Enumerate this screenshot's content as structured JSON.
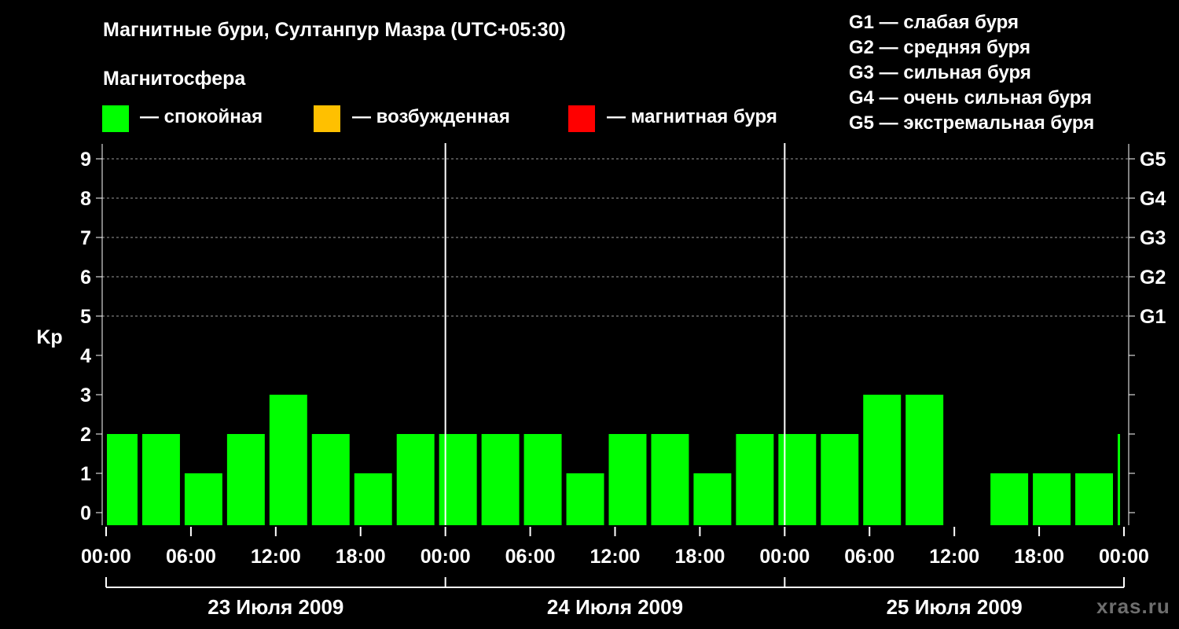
{
  "title": "Магнитные бури, Султанпур Мазра (UTC+05:30)",
  "legend": {
    "title": "Магнитосфера",
    "items": [
      {
        "label": "— спокойная",
        "color": "#00ff00"
      },
      {
        "label": "— возбужденная",
        "color": "#ffc000"
      },
      {
        "label": "— магнитная буря",
        "color": "#ff0000"
      }
    ]
  },
  "storm_scale": [
    "G1 — слабая буря",
    "G2 — средняя буря",
    "G3 — сильная буря",
    "G4 — очень сильная буря",
    "G5 — экстремальная буря"
  ],
  "watermark": "xras.ru",
  "chart_data": {
    "type": "bar",
    "ylabel": "Kp",
    "ylim": [
      0,
      9
    ],
    "y_ticks": [
      "0",
      "1",
      "2",
      "3",
      "4",
      "5",
      "6",
      "7",
      "8",
      "9"
    ],
    "right_ticks": [
      {
        "kp": 5,
        "label": "G1"
      },
      {
        "kp": 6,
        "label": "G2"
      },
      {
        "kp": 7,
        "label": "G3"
      },
      {
        "kp": 8,
        "label": "G4"
      },
      {
        "kp": 9,
        "label": "G5"
      }
    ],
    "x_tick_labels": [
      "00:00",
      "06:00",
      "12:00",
      "18:00",
      "00:00",
      "06:00",
      "12:00",
      "18:00",
      "00:00",
      "06:00",
      "12:00",
      "18:00",
      "00:00"
    ],
    "days": [
      "23 Июля 2009",
      "24 Июля 2009",
      "25 Июля 2009"
    ],
    "grid": "dashed horizontal lines at Kp 5–9",
    "series": [
      {
        "color": "#00ff00",
        "bars": [
          {
            "start": "2009-07-23 00:00",
            "end": "2009-07-23 02:30",
            "kp": 2
          },
          {
            "start": "2009-07-23 02:30",
            "end": "2009-07-23 05:30",
            "kp": 2
          },
          {
            "start": "2009-07-23 05:30",
            "end": "2009-07-23 08:30",
            "kp": 1
          },
          {
            "start": "2009-07-23 08:30",
            "end": "2009-07-23 11:30",
            "kp": 2
          },
          {
            "start": "2009-07-23 11:30",
            "end": "2009-07-23 14:30",
            "kp": 3
          },
          {
            "start": "2009-07-23 14:30",
            "end": "2009-07-23 17:30",
            "kp": 2
          },
          {
            "start": "2009-07-23 17:30",
            "end": "2009-07-23 20:30",
            "kp": 1
          },
          {
            "start": "2009-07-23 20:30",
            "end": "2009-07-23 23:30",
            "kp": 2
          },
          {
            "start": "2009-07-23 23:30",
            "end": "2009-07-24 02:30",
            "kp": 2
          },
          {
            "start": "2009-07-24 02:30",
            "end": "2009-07-24 05:30",
            "kp": 2
          },
          {
            "start": "2009-07-24 05:30",
            "end": "2009-07-24 08:30",
            "kp": 2
          },
          {
            "start": "2009-07-24 08:30",
            "end": "2009-07-24 11:30",
            "kp": 1
          },
          {
            "start": "2009-07-24 11:30",
            "end": "2009-07-24 14:30",
            "kp": 2
          },
          {
            "start": "2009-07-24 14:30",
            "end": "2009-07-24 17:30",
            "kp": 2
          },
          {
            "start": "2009-07-24 17:30",
            "end": "2009-07-24 20:30",
            "kp": 1
          },
          {
            "start": "2009-07-24 20:30",
            "end": "2009-07-24 23:30",
            "kp": 2
          },
          {
            "start": "2009-07-24 23:30",
            "end": "2009-07-25 02:30",
            "kp": 2
          },
          {
            "start": "2009-07-25 02:30",
            "end": "2009-07-25 05:30",
            "kp": 2
          },
          {
            "start": "2009-07-25 05:30",
            "end": "2009-07-25 08:30",
            "kp": 3
          },
          {
            "start": "2009-07-25 08:30",
            "end": "2009-07-25 11:30",
            "kp": 3
          },
          {
            "start": "2009-07-25 11:30",
            "end": "2009-07-25 14:30",
            "kp": 0
          },
          {
            "start": "2009-07-25 14:30",
            "end": "2009-07-25 17:30",
            "kp": 1
          },
          {
            "start": "2009-07-25 17:30",
            "end": "2009-07-25 20:30",
            "kp": 1
          },
          {
            "start": "2009-07-25 20:30",
            "end": "2009-07-25 23:30",
            "kp": 1
          },
          {
            "start": "2009-07-25 23:30",
            "end": "2009-07-26 00:00",
            "kp": 2
          }
        ]
      }
    ]
  }
}
